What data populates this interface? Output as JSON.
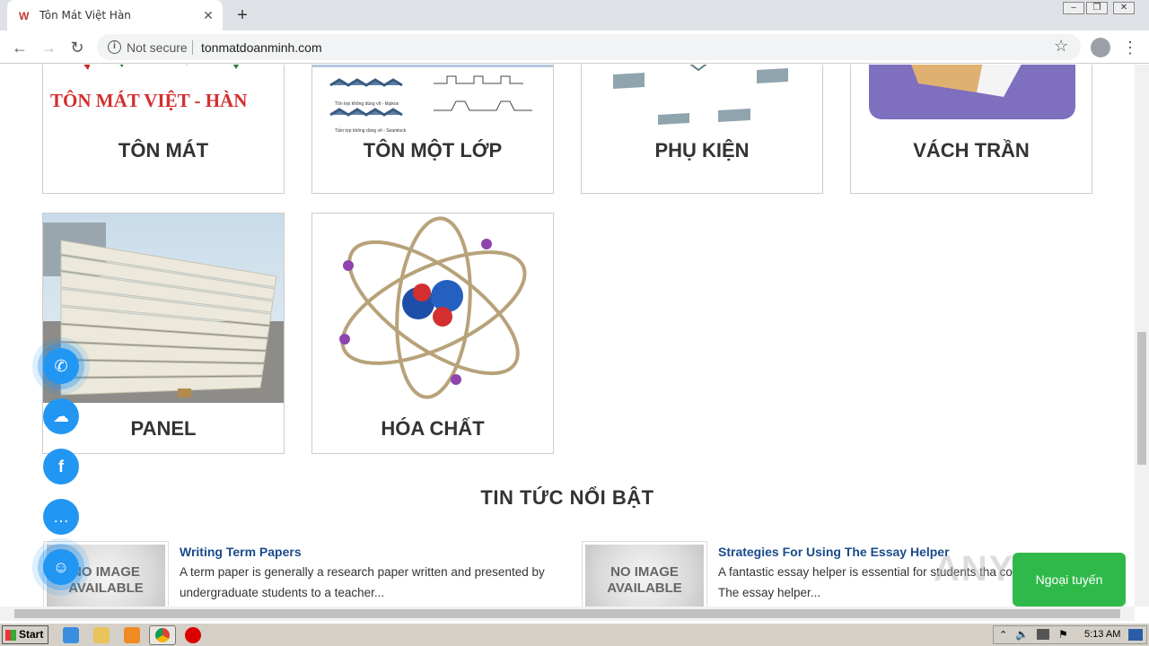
{
  "browser": {
    "tab_title": "Tôn Mát Việt Hàn",
    "close_glyph": "✕",
    "newtab_glyph": "+",
    "security_label": "Not secure",
    "url": "tonmatdoanminh.com"
  },
  "products": [
    {
      "label": "TÔN MÁT",
      "image_text": "TÔN MÁT VIỆT - HÀN"
    },
    {
      "label": "TÔN MỘT LỚP",
      "image_caption_1": "Tôn lợp không dùng vít - klipkos",
      "image_caption_2": "Tấm lợp không dùng vít - Seamlock"
    },
    {
      "label": "PHỤ KIỆN"
    },
    {
      "label": "VÁCH TRẦN"
    },
    {
      "label": "PANEL"
    },
    {
      "label": "HÓA CHẤT"
    }
  ],
  "news_section": {
    "title": "TIN TỨC NỔI BẬT",
    "no_image_text": "NO IMAGE AVAILABLE",
    "items": [
      {
        "title": "Writing Term Papers",
        "excerpt": "A term paper is generally a research paper written and presented by undergraduate students to a teacher..."
      },
      {
        "title": "Strategies For Using The Essay Helper",
        "excerpt": "A fantastic essay helper is essential for students tha course in school. The essay helper..."
      }
    ]
  },
  "chat_widget": {
    "label": "Ngoại tuyến"
  },
  "watermark": "ANY RUN",
  "taskbar": {
    "start_label": "Start",
    "clock": "5:13 AM"
  },
  "icons": [
    "whatsapp-icon",
    "wechat-icon",
    "facebook-icon",
    "messenger-icon",
    "contact-icon"
  ],
  "colors": {
    "accent": "#2196f3",
    "news_title": "#1a4b8c",
    "chat_green": "#2fb94a"
  }
}
